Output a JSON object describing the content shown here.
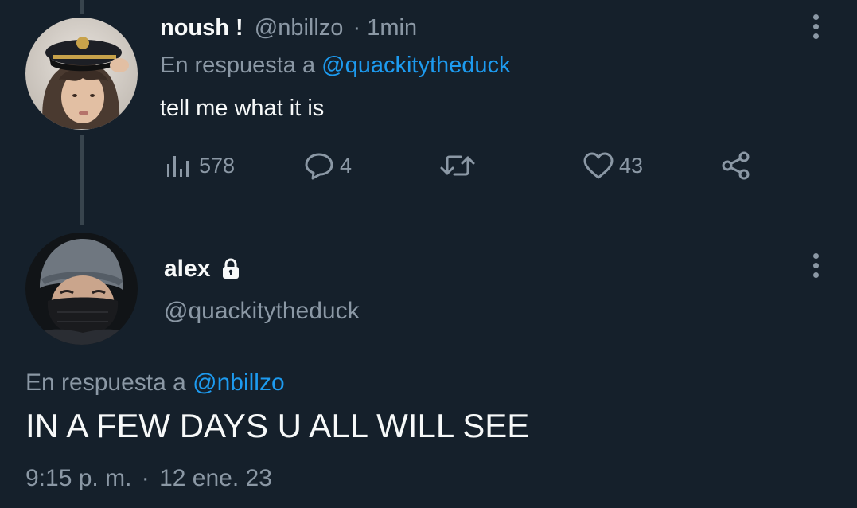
{
  "reply": {
    "display_name": "noush !",
    "handle": "@nbillzo",
    "separator": "·",
    "time": "1min",
    "replying_to_label": "En respuesta a",
    "replying_to_handle": "@quackitytheduck",
    "text": "tell me what it is",
    "actions": {
      "views_count": "578",
      "replies_count": "4",
      "retweets_count": "",
      "likes_count": "43"
    }
  },
  "main": {
    "display_name": "alex",
    "handle": "@quackitytheduck",
    "replying_to_label": "En respuesta a",
    "replying_to_handle": "@nbillzo",
    "text": "IN A FEW DAYS U ALL WILL SEE",
    "timestamp": "9:15 p. m.",
    "separator": "·",
    "date": "12 ene. 23"
  },
  "colors": {
    "background": "#15202b",
    "primary_text": "#f7f9f9",
    "secondary_text": "#8b98a5",
    "link": "#1d9bf0",
    "thread_line": "#38444d"
  },
  "icons": [
    "views-icon",
    "reply-icon",
    "retweet-icon",
    "like-icon",
    "share-icon",
    "lock-icon",
    "more-icon"
  ]
}
